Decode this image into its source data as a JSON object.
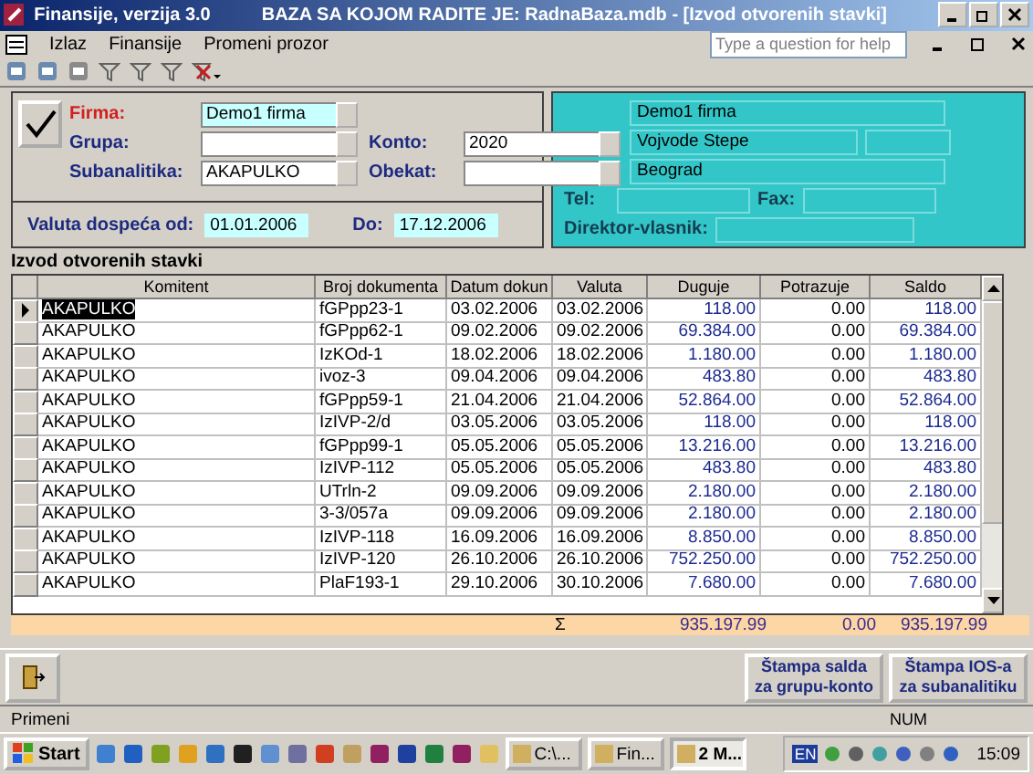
{
  "window": {
    "app_title": "Finansije, verzija 3.0",
    "document_title": "BAZA SA KOJOM RADITE JE: RadnaBaza.mdb - [Izvod otvorenih stavki]"
  },
  "menu": [
    "Izlaz",
    "Finansije",
    "Promeni prozor"
  ],
  "help": {
    "placeholder": "Type a question for help"
  },
  "filter": {
    "firma": {
      "label": "Firma:",
      "value": "Demo1 firma"
    },
    "grupa": {
      "label": "Grupa:"
    },
    "subanalitika": {
      "label": "Subanalitika:",
      "value": "AKAPULKO"
    },
    "konto": {
      "label": "Konto:",
      "value": "2020"
    },
    "obekat": {
      "label": "Obekat:"
    },
    "valuta_od": {
      "label": "Valuta dospeća od:",
      "value": "01.01.2006"
    },
    "do": {
      "label": "Do:",
      "value": "17.12.2006"
    }
  },
  "company": {
    "name": "Demo1 firma",
    "address": "Vojvode Stepe",
    "city": "Beograd",
    "tel_label": "Tel:",
    "fax_label": "Fax:",
    "director_label": "Direktor-vlasnik:"
  },
  "section_title": "Izvod otvorenih stavki",
  "table": {
    "columns": [
      "Komitent",
      "Broj dokumenta",
      "Datum dokun",
      "Valuta",
      "Duguje",
      "Potrazuje",
      "Saldo"
    ],
    "rows": [
      {
        "current": true,
        "cells": [
          "AKAPULKO",
          "fGPpp23-1",
          "03.02.2006",
          "03.02.2006",
          "118.00",
          "0.00",
          "118.00"
        ]
      },
      {
        "current": false,
        "cells": [
          "AKAPULKO",
          "fGPpp62-1",
          "09.02.2006",
          "09.02.2006",
          "69.384.00",
          "0.00",
          "69.384.00"
        ]
      },
      {
        "current": false,
        "cells": [
          "AKAPULKO",
          "IzKOd-1",
          "18.02.2006",
          "18.02.2006",
          "1.180.00",
          "0.00",
          "1.180.00"
        ]
      },
      {
        "current": false,
        "cells": [
          "AKAPULKO",
          "ivoz-3",
          "09.04.2006",
          "09.04.2006",
          "483.80",
          "0.00",
          "483.80"
        ]
      },
      {
        "current": false,
        "cells": [
          "AKAPULKO",
          "fGPpp59-1",
          "21.04.2006",
          "21.04.2006",
          "52.864.00",
          "0.00",
          "52.864.00"
        ]
      },
      {
        "current": false,
        "cells": [
          "AKAPULKO",
          "IzIVP-2/d",
          "03.05.2006",
          "03.05.2006",
          "118.00",
          "0.00",
          "118.00"
        ]
      },
      {
        "current": false,
        "cells": [
          "AKAPULKO",
          "fGPpp99-1",
          "05.05.2006",
          "05.05.2006",
          "13.216.00",
          "0.00",
          "13.216.00"
        ]
      },
      {
        "current": false,
        "cells": [
          "AKAPULKO",
          "IzIVP-112",
          "05.05.2006",
          "05.05.2006",
          "483.80",
          "0.00",
          "483.80"
        ]
      },
      {
        "current": false,
        "cells": [
          "AKAPULKO",
          "UTrln-2",
          "09.09.2006",
          "09.09.2006",
          "2.180.00",
          "0.00",
          "2.180.00"
        ]
      },
      {
        "current": false,
        "cells": [
          "AKAPULKO",
          "3-3/057a",
          "09.09.2006",
          "09.09.2006",
          "2.180.00",
          "0.00",
          "2.180.00"
        ]
      },
      {
        "current": false,
        "cells": [
          "AKAPULKO",
          "IzIVP-118",
          "16.09.2006",
          "16.09.2006",
          "8.850.00",
          "0.00",
          "8.850.00"
        ]
      },
      {
        "current": false,
        "cells": [
          "AKAPULKO",
          "IzIVP-120",
          "26.10.2006",
          "26.10.2006",
          "752.250.00",
          "0.00",
          "752.250.00"
        ]
      },
      {
        "current": false,
        "cells": [
          "AKAPULKO",
          "PlaF193-1",
          "29.10.2006",
          "30.10.2006",
          "7.680.00",
          "0.00",
          "7.680.00"
        ]
      }
    ],
    "totals": {
      "sigma": "Σ",
      "duguje": "935.197.99",
      "potrazuje": "0.00",
      "saldo": "935.197.99"
    }
  },
  "buttons": [
    "Štampa salda za grupu-konto",
    "Štampa IOS-a za subanalitiku"
  ],
  "status_bar": {
    "message": "Primeni",
    "num": "NUM"
  },
  "taskbar": {
    "start": "Start",
    "tasks": [
      {
        "label": "C:\\...",
        "selected": false
      },
      {
        "label": "Fin...",
        "selected": false
      },
      {
        "label": "2 M...",
        "selected": true
      }
    ],
    "language": "EN",
    "clock": "15:09"
  }
}
